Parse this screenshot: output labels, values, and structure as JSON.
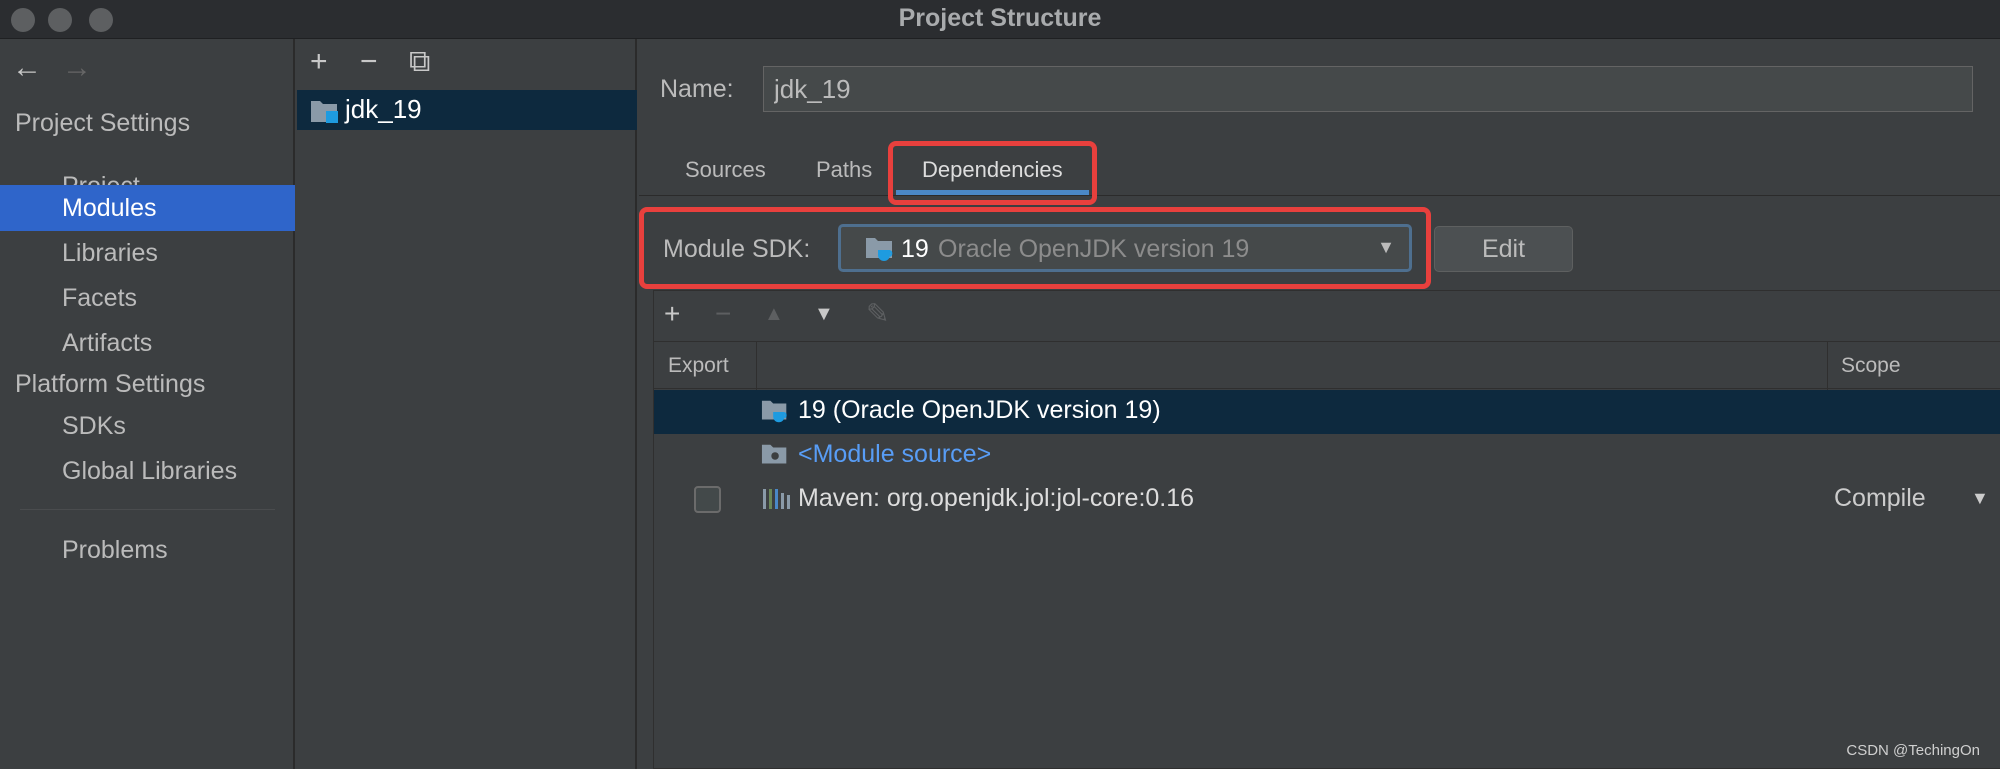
{
  "window": {
    "title": "Project Structure"
  },
  "nav": {
    "back_glyph": "←",
    "forward_glyph": "→",
    "project_settings": "Project Settings",
    "project_items": [
      "Project",
      "Modules",
      "Libraries",
      "Facets",
      "Artifacts"
    ],
    "platform_settings": "Platform Settings",
    "platform_items": [
      "SDKs",
      "Global Libraries"
    ],
    "problems": "Problems",
    "selected": "Modules"
  },
  "modules": {
    "toolbar": {
      "add": "+",
      "remove": "−",
      "copy": "⧉"
    },
    "items": [
      {
        "label": "jdk_19"
      }
    ]
  },
  "detail": {
    "name_label": "Name:",
    "name_value": "jdk_19",
    "tabs": {
      "sources": "Sources",
      "paths": "Paths",
      "dependencies": "Dependencies"
    },
    "active_tab": "Dependencies",
    "sdk_label": "Module SDK:",
    "sdk_version": "19",
    "sdk_desc": "Oracle OpenJDK version 19",
    "edit_label": "Edit"
  },
  "dependencies": {
    "toolbar": {
      "add": "+",
      "remove": "−",
      "up": "▲",
      "down": "▼",
      "edit": "✎"
    },
    "headers": {
      "export": "Export",
      "scope": "Scope"
    },
    "rows": [
      {
        "text": "19 (Oracle OpenJDK version 19)",
        "icon": "sdk-folder-icon"
      },
      {
        "text": "<Module source>",
        "icon": "module-source-folder-icon"
      },
      {
        "text": "Maven: org.openjdk.jol:jol-core:0.16",
        "icon": "maven-library-icon",
        "scope": "Compile"
      }
    ]
  },
  "watermark": "CSDN @TechingOn",
  "colors": {
    "accent": "#2f65ca",
    "selection": "#0d293e",
    "highlight": "#e8403d",
    "link": "#589df6"
  }
}
